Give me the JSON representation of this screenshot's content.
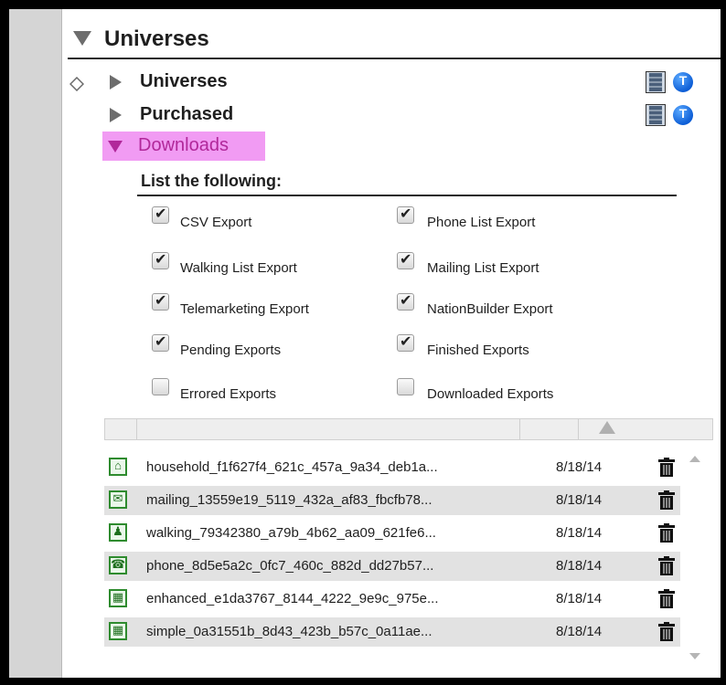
{
  "section": {
    "title": "Universes"
  },
  "tree": {
    "universes_label": "Universes",
    "purchased_label": "Purchased",
    "downloads_label": "Downloads"
  },
  "list": {
    "title": "List the following:",
    "options": [
      {
        "label": "CSV Export",
        "checked": true
      },
      {
        "label": "Phone List Export",
        "checked": true
      },
      {
        "label": "Walking List Export",
        "checked": true
      },
      {
        "label": "Mailing List Export",
        "checked": true
      },
      {
        "label": "Telemarketing Export",
        "checked": true
      },
      {
        "label": "NationBuilder Export",
        "checked": true
      },
      {
        "label": "Pending Exports",
        "checked": true
      },
      {
        "label": "Finished Exports",
        "checked": true
      },
      {
        "label": "Errored Exports",
        "checked": false
      },
      {
        "label": "Downloaded Exports",
        "checked": false
      }
    ]
  },
  "files": [
    {
      "icon": "house-icon",
      "name": "household_f1f627f4_621c_457a_9a34_deb1a...",
      "date": "8/18/14"
    },
    {
      "icon": "mailbox-icon",
      "name": "mailing_13559e19_5119_432a_af83_fbcfb78...",
      "date": "8/18/14"
    },
    {
      "icon": "walker-icon",
      "name": "walking_79342380_a79b_4b62_aa09_621fe6...",
      "date": "8/18/14"
    },
    {
      "icon": "phone-icon",
      "name": "phone_8d5e5a2c_0fc7_460c_882d_dd27b57...",
      "date": "8/18/14"
    },
    {
      "icon": "spreadsheet-icon",
      "name": "enhanced_e1da3767_8144_4222_9e9c_975e...",
      "date": "8/18/14"
    },
    {
      "icon": "spreadsheet-icon",
      "name": "simple_0a31551b_8d43_423b_b57c_0a11ae...",
      "date": "8/18/14"
    }
  ],
  "colors": {
    "highlight": "#f19bf3",
    "accent": "#b1289a",
    "icon_green": "#2e8b2e"
  }
}
